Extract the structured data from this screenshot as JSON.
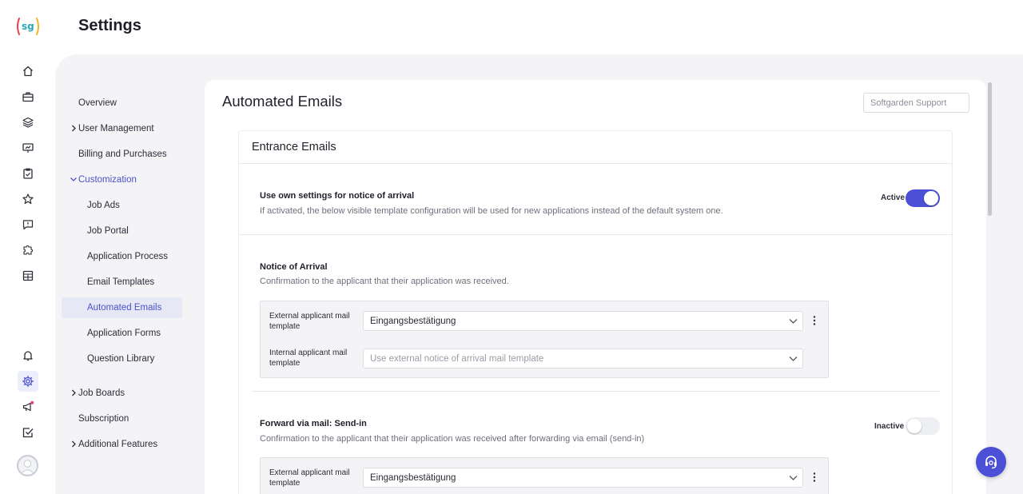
{
  "app": {
    "logo_text": "sg"
  },
  "page_title": "Settings",
  "rail": {
    "items": [
      {
        "icon": "home-icon"
      },
      {
        "icon": "briefcase-icon"
      },
      {
        "icon": "layers-icon"
      },
      {
        "icon": "presentation-icon"
      },
      {
        "icon": "clipboard-check-icon"
      },
      {
        "icon": "star-icon"
      },
      {
        "icon": "message-alert-icon"
      },
      {
        "icon": "puzzle-icon"
      },
      {
        "icon": "calendar-grid-icon"
      }
    ],
    "bottom": [
      {
        "icon": "bell-icon"
      },
      {
        "icon": "gear-icon",
        "active": true
      },
      {
        "icon": "megaphone-icon"
      },
      {
        "icon": "checkbox-icon"
      }
    ]
  },
  "settings_nav": {
    "items": [
      {
        "label": "Overview"
      },
      {
        "label": "User Management",
        "chevron": "right"
      },
      {
        "label": "Billing and Purchases"
      },
      {
        "label": "Customization",
        "chevron": "down",
        "open": true
      },
      {
        "label": "Job Ads"
      },
      {
        "label": "Job Portal"
      },
      {
        "label": "Application Process"
      },
      {
        "label": "Email Templates"
      },
      {
        "label": "Automated Emails",
        "active": true
      },
      {
        "label": "Application Forms"
      },
      {
        "label": "Question Library"
      },
      {
        "label": "Job Boards",
        "chevron": "right"
      },
      {
        "label": "Subscription"
      },
      {
        "label": "Additional Features",
        "chevron": "right"
      }
    ]
  },
  "main": {
    "title": "Automated Emails",
    "support_field": "Softgarden Support",
    "section_title": "Entrance Emails",
    "own_settings": {
      "title": "Use own settings for notice of arrival",
      "description": "If activated, the below visible template configuration will be used for new applications instead of the default system one.",
      "toggle_label": "Active",
      "toggle_on": true
    },
    "notice_of_arrival": {
      "title": "Notice of Arrival",
      "description": "Confirmation to the applicant that their application was received.",
      "external_label": "External applicant mail template",
      "external_value": "Eingangsbestätigung",
      "internal_label": "Internal applicant mail template",
      "internal_placeholder": "Use external notice of arrival mail template"
    },
    "forward_via_mail": {
      "title": "Forward via mail: Send-in",
      "description": "Confirmation to the applicant that their application was received after forwarding via email (send-in)",
      "toggle_label": "Inactive",
      "toggle_on": false,
      "external_label": "External applicant mail template",
      "external_value": "Eingangsbestätigung"
    }
  },
  "colors": {
    "accent": "#4b50d6",
    "nav_active_bg": "#e6e8f6",
    "panel_bg": "#f4f4f7"
  }
}
